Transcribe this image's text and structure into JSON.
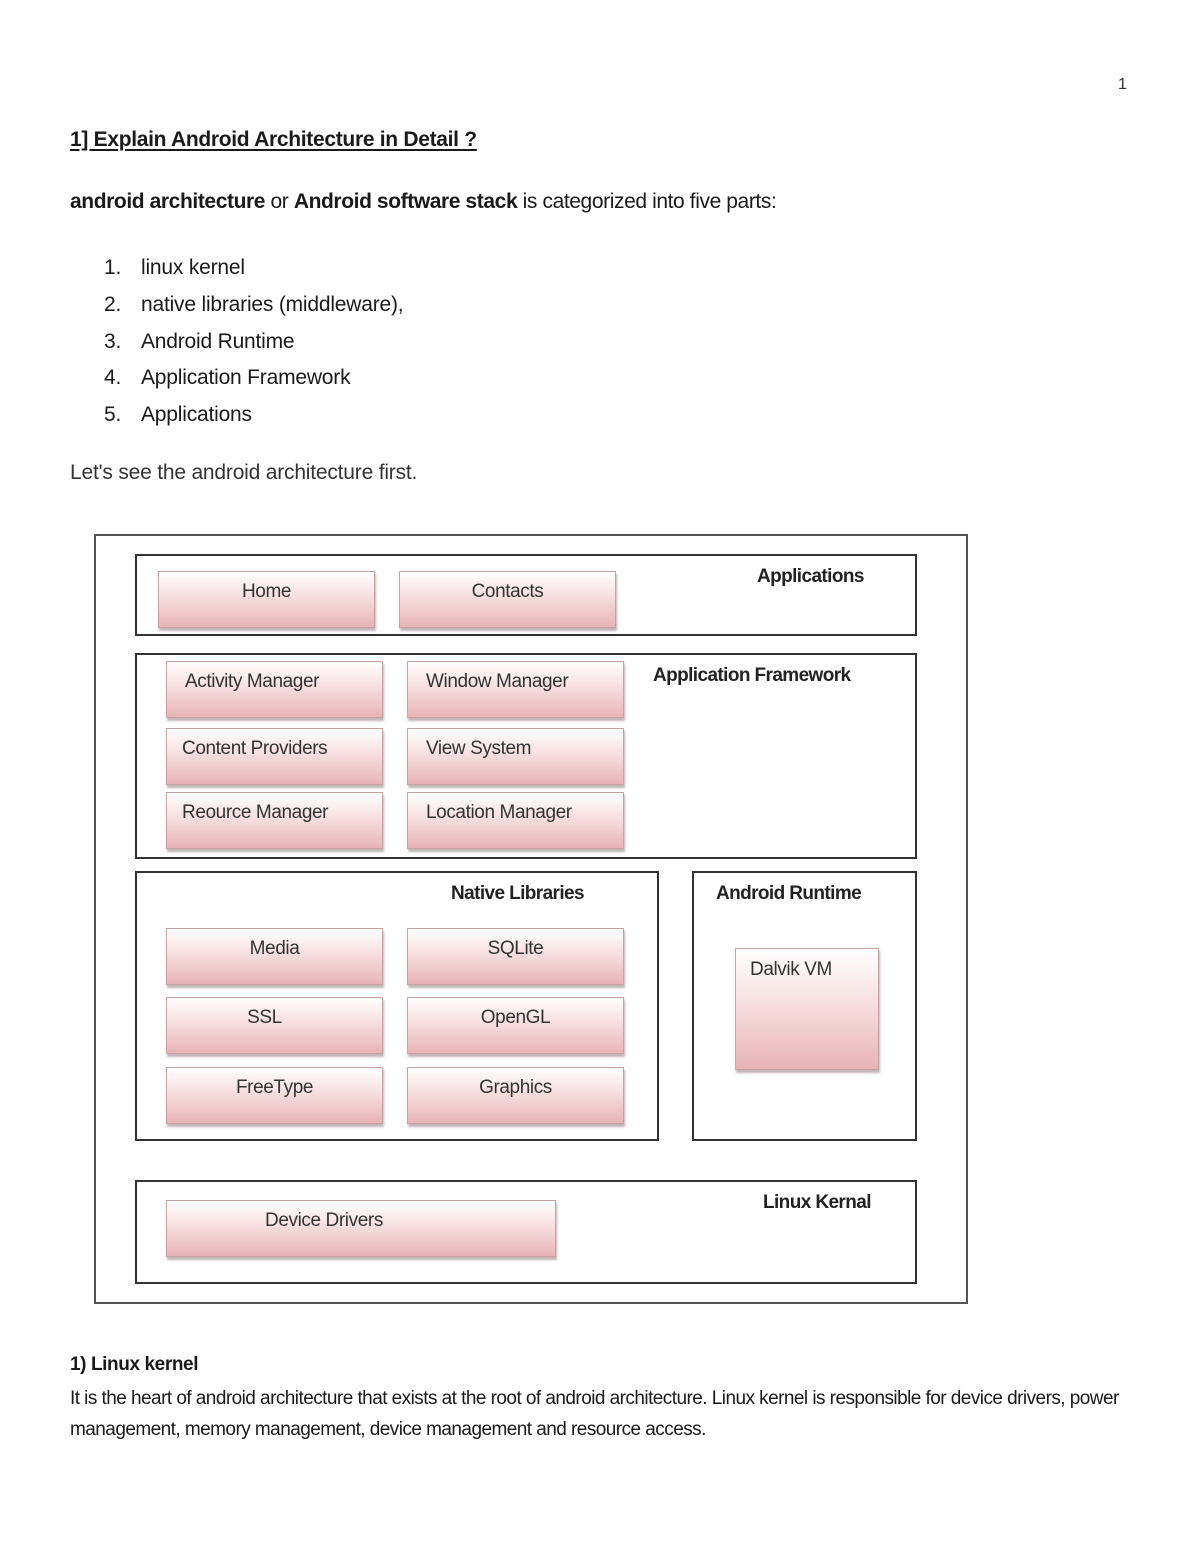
{
  "page_number": "1",
  "heading": "1] Explain Android Architecture in Detail ?",
  "intro": {
    "bold1": "android architecture",
    "mid": " or ",
    "bold2": "Android software stack",
    "rest": " is categorized into five parts:"
  },
  "parts": [
    {
      "num": "1.",
      "text": "linux kernel"
    },
    {
      "num": "2.",
      "text": "native libraries (middleware),"
    },
    {
      "num": "3.",
      "text": "Android Runtime"
    },
    {
      "num": "4.",
      "text": "Application Framework"
    },
    {
      "num": "5.",
      "text": "Applications"
    }
  ],
  "lets_see": "Let's see the android architecture first.",
  "diagram": {
    "applications": {
      "title": "Applications",
      "items": [
        "Home",
        "Contacts"
      ]
    },
    "framework": {
      "title": "Application Framework",
      "items": [
        "Activity Manager",
        "Window Manager",
        "Content Providers",
        "View System",
        "Reource Manager",
        "Location Manager"
      ]
    },
    "native": {
      "title": "Native Libraries",
      "items": [
        "Media",
        "SQLite",
        "SSL",
        "OpenGL",
        "FreeType",
        "Graphics"
      ]
    },
    "runtime": {
      "title": "Android Runtime",
      "items": [
        "Dalvik VM"
      ]
    },
    "kernel": {
      "title": "Linux Kernal",
      "items": [
        "Device Drivers"
      ]
    }
  },
  "section1": {
    "title": "1) Linux kernel",
    "body": "It is the heart of android architecture that exists at the root of android architecture. Linux kernel is responsible for device drivers, power management, memory management, device management and resource access."
  }
}
